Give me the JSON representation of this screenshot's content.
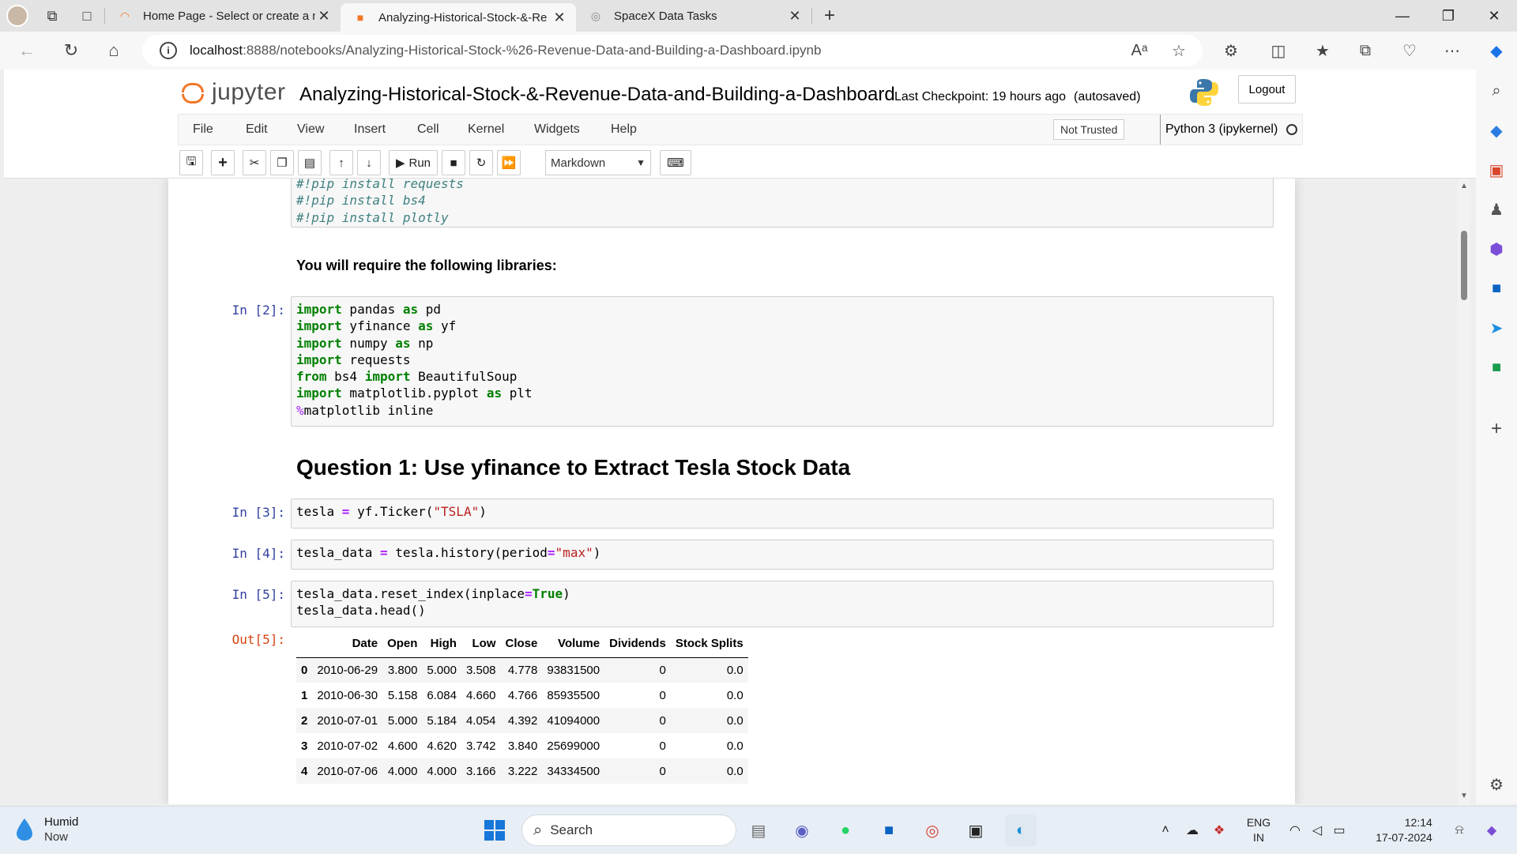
{
  "browser": {
    "tabs": [
      {
        "label": "Home Page - Select or create a n",
        "active": false
      },
      {
        "label": "Analyzing-Historical-Stock-&-Re",
        "active": true
      },
      {
        "label": "SpaceX Data Tasks",
        "active": false
      }
    ],
    "url_host": "localhost",
    "url_path": ":8888/notebooks/Analyzing-Historical-Stock-%26-Revenue-Data-and-Building-a-Dashboard.ipynb"
  },
  "jupyter": {
    "logo_text": "jupyter",
    "notebook_title": "Analyzing-Historical-Stock-&-Revenue-Data-and-Building-a-Dashboard",
    "checkpoint": "Last Checkpoint: 19 hours ago",
    "autosave": "(autosaved)",
    "logout_label": "Logout",
    "menu": [
      "File",
      "Edit",
      "View",
      "Insert",
      "Cell",
      "Kernel",
      "Widgets",
      "Help"
    ],
    "trust_label": "Not Trusted",
    "kernel_name": "Python 3 (ipykernel)",
    "toolbar": {
      "run_label": "Run",
      "cell_type": "Markdown"
    }
  },
  "cells": {
    "pip_lines": [
      "#!pip install requests",
      "#!pip install bs4",
      "#!pip install plotly"
    ],
    "libs_text": "You will require the following libraries:",
    "in2": "In [2]:",
    "q1_heading": "Question 1: Use yfinance to Extract Tesla Stock Data",
    "in3": "In [3]:",
    "in4": "In [4]:",
    "in5": "In [5]:",
    "out5": "Out[5]:"
  },
  "dataframe": {
    "columns": [
      "",
      "Date",
      "Open",
      "High",
      "Low",
      "Close",
      "Volume",
      "Dividends",
      "Stock Splits"
    ],
    "rows": [
      [
        "0",
        "2010-06-29",
        "3.800",
        "5.000",
        "3.508",
        "4.778",
        "93831500",
        "0",
        "0.0"
      ],
      [
        "1",
        "2010-06-30",
        "5.158",
        "6.084",
        "4.660",
        "4.766",
        "85935500",
        "0",
        "0.0"
      ],
      [
        "2",
        "2010-07-01",
        "5.000",
        "5.184",
        "4.054",
        "4.392",
        "41094000",
        "0",
        "0.0"
      ],
      [
        "3",
        "2010-07-02",
        "4.600",
        "4.620",
        "3.742",
        "3.840",
        "25699000",
        "0",
        "0.0"
      ],
      [
        "4",
        "2010-07-06",
        "4.000",
        "4.000",
        "3.166",
        "3.222",
        "34334500",
        "0",
        "0.0"
      ]
    ]
  },
  "taskbar": {
    "weather_title": "Humid",
    "weather_sub": "Now",
    "search_label": "Search",
    "lang_line1": "ENG",
    "lang_line2": "IN",
    "time": "12:14",
    "date": "17-07-2024"
  },
  "colors": {
    "jupyter_orange": "#f37626",
    "in_prompt": "#303f9f",
    "out_prompt": "#d84315",
    "code_keyword": "#008000",
    "code_string": "#ba2121"
  }
}
